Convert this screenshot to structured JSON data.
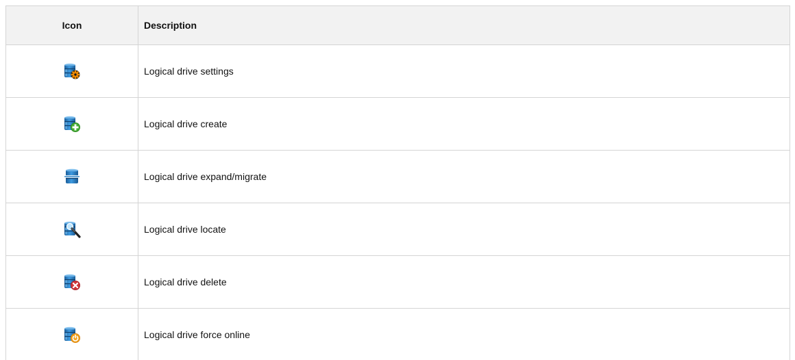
{
  "table": {
    "headers": {
      "icon": "Icon",
      "description": "Description"
    },
    "rows": [
      {
        "icon": "drive-settings-icon",
        "description": "Logical drive settings"
      },
      {
        "icon": "drive-create-icon",
        "description": "Logical drive create"
      },
      {
        "icon": "drive-expand-migrate-icon",
        "description": "Logical drive expand/migrate"
      },
      {
        "icon": "drive-locate-icon",
        "description": "Logical drive locate"
      },
      {
        "icon": "drive-delete-icon",
        "description": "Logical drive delete"
      },
      {
        "icon": "drive-force-online-icon",
        "description": "Logical drive force online"
      }
    ]
  },
  "colors": {
    "drive_blue": "#2a7fc1",
    "gear_orange": "#f08a00",
    "plus_green": "#3a9a2a",
    "delete_red": "#d0363a",
    "power_orange": "#f3a21b"
  }
}
